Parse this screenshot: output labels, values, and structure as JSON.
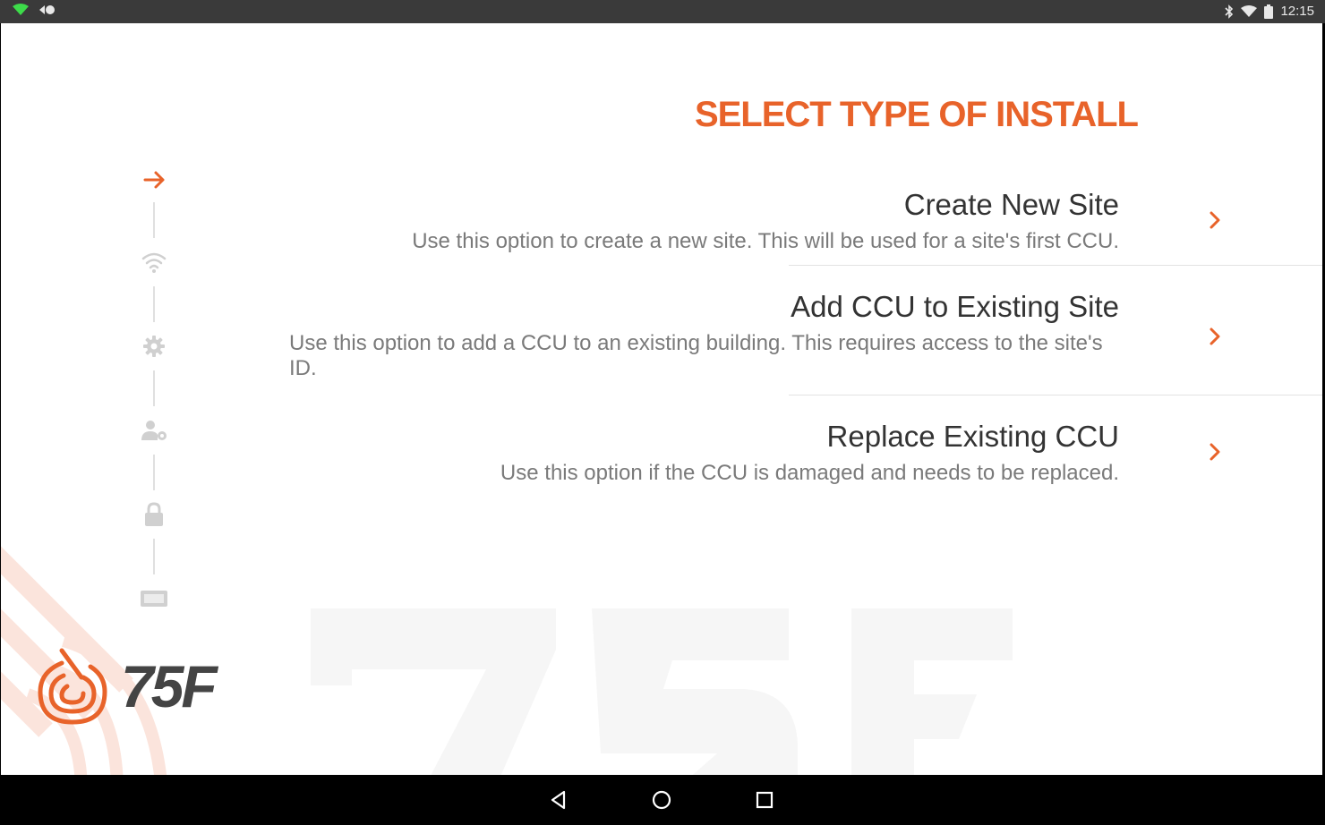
{
  "status_bar": {
    "time": "12:15",
    "icons": [
      "wifi-icon",
      "data-icon",
      "bluetooth-icon",
      "wifi-signal-icon",
      "battery-icon"
    ]
  },
  "page": {
    "title": "SELECT TYPE OF INSTALL",
    "accent_color": "#e8632a"
  },
  "options": [
    {
      "title": "Create New Site",
      "description": "Use this option to create a new site. This will be used for a site's first CCU."
    },
    {
      "title": "Add CCU to Existing Site",
      "description": "Use this option to add a CCU to an existing building. This requires access to the site's ID."
    },
    {
      "title": "Replace Existing CCU",
      "description": "Use this option if the CCU is damaged and needs to be replaced."
    }
  ],
  "steps": [
    {
      "icon": "arrow-right-icon",
      "active": true
    },
    {
      "icon": "wifi-icon",
      "active": false
    },
    {
      "icon": "gear-icon",
      "active": false
    },
    {
      "icon": "user-settings-icon",
      "active": false
    },
    {
      "icon": "lock-icon",
      "active": false
    },
    {
      "icon": "device-icon",
      "active": false
    }
  ],
  "logo": {
    "text": "75F"
  },
  "watermark": {
    "text": "75F"
  },
  "nav_bar": {
    "buttons": [
      "back-icon",
      "home-icon",
      "recents-icon"
    ]
  }
}
